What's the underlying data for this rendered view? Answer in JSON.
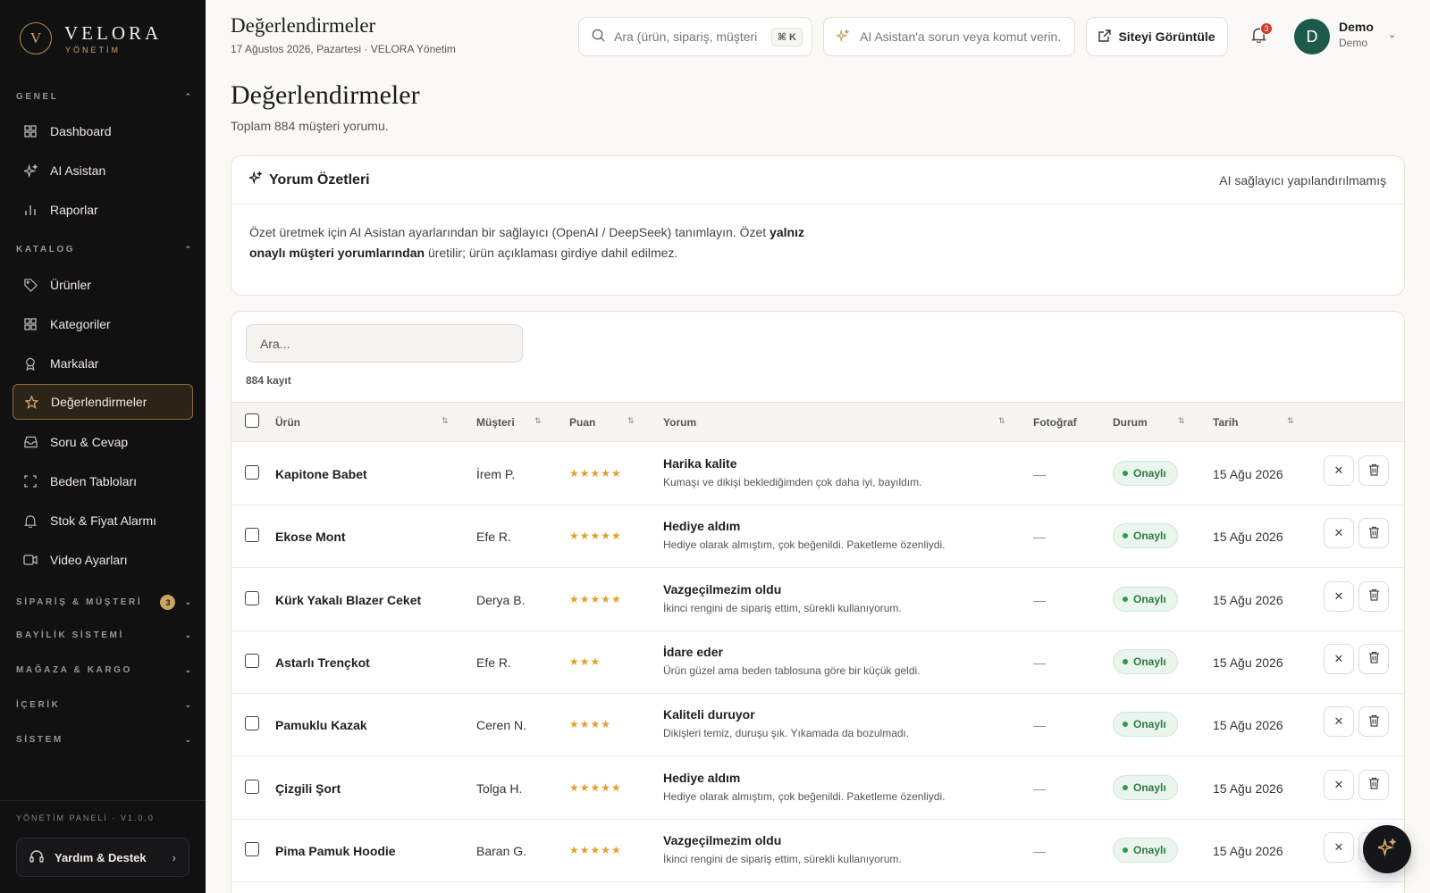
{
  "brand": {
    "logo_letter": "V",
    "name": "VELORA",
    "subtitle": "YÖNETİM"
  },
  "sidebar": {
    "sections": [
      {
        "label": "GENEL",
        "state": "expanded",
        "items": [
          {
            "label": "Dashboard",
            "icon": "grid-icon"
          },
          {
            "label": "AI Asistan",
            "icon": "sparkle-icon"
          },
          {
            "label": "Raporlar",
            "icon": "bar-chart-icon"
          }
        ]
      },
      {
        "label": "KATALOG",
        "state": "expanded",
        "items": [
          {
            "label": "Ürünler",
            "icon": "tag-icon"
          },
          {
            "label": "Kategoriler",
            "icon": "grid-icon"
          },
          {
            "label": "Markalar",
            "icon": "award-icon"
          },
          {
            "label": "Değerlendirmeler",
            "icon": "star-icon",
            "active": true
          },
          {
            "label": "Soru & Cevap",
            "icon": "inbox-icon"
          },
          {
            "label": "Beden Tabloları",
            "icon": "frame-icon"
          },
          {
            "label": "Stok & Fiyat Alarmı",
            "icon": "bell-icon"
          },
          {
            "label": "Video Ayarları",
            "icon": "video-icon"
          }
        ]
      },
      {
        "label": "SİPARİŞ & MÜŞTERİ",
        "state": "collapsed",
        "badge": "3"
      },
      {
        "label": "BAYİLİK SİSTEMİ",
        "state": "collapsed"
      },
      {
        "label": "MAĞAZA & KARGO",
        "state": "collapsed"
      },
      {
        "label": "İÇERİK",
        "state": "collapsed"
      },
      {
        "label": "SİSTEM",
        "state": "collapsed"
      }
    ],
    "version": "YÖNETİM PANELİ · V1.0.0",
    "help_label": "Yardım & Destek"
  },
  "header": {
    "title": "Değerlendirmeler",
    "date": "17 Ağustos 2026, Pazartesi · VELORA Yönetim",
    "search_placeholder": "Ara (ürün, sipariş, müşteri...",
    "search_shortcut": "⌘ K",
    "ai_placeholder": "AI Asistan'a sorun veya komut verin...",
    "view_site_label": "Siteyi Görüntüle",
    "notification_count": "3",
    "user": {
      "initial": "D",
      "name": "Demo",
      "role": "Demo"
    }
  },
  "page": {
    "title": "Değerlendirmeler",
    "subtitle": "Toplam 884 müşteri yorumu."
  },
  "summary": {
    "title": "Yorum Özetleri",
    "status": "AI sağlayıcı yapılandırılmamış",
    "body_pre": "Özet üretmek için AI Asistan ayarlarından bir sağlayıcı (OpenAI / DeepSeek) tanımlayın. Özet ",
    "body_bold": "yalnız onaylı müşteri yorumlarından",
    "body_post": " üretilir; ürün açıklaması girdiye dahil edilmez."
  },
  "reviews": {
    "search_placeholder": "Ara...",
    "record_count": "884 kayıt",
    "columns": [
      "Ürün",
      "Müşteri",
      "Puan",
      "Yorum",
      "Fotoğraf",
      "Durum",
      "Tarih"
    ],
    "rows": [
      {
        "product": "Kapitone Babet",
        "customer": "İrem P.",
        "rating": 5,
        "title": "Harika kalite",
        "text": "Kumaşı ve dikişi beklediğimden çok daha iyi, bayıldım.",
        "photo": "—",
        "status": "Onaylı",
        "date": "15 Ağu 2026"
      },
      {
        "product": "Ekose Mont",
        "customer": "Efe R.",
        "rating": 5,
        "title": "Hediye aldım",
        "text": "Hediye olarak almıştım, çok beğenildi. Paketleme özenliydi.",
        "photo": "—",
        "status": "Onaylı",
        "date": "15 Ağu 2026"
      },
      {
        "product": "Kürk Yakalı Blazer Ceket",
        "customer": "Derya B.",
        "rating": 5,
        "title": "Vazgeçilmezim oldu",
        "text": "İkinci rengini de sipariş ettim, sürekli kullanıyorum.",
        "photo": "—",
        "status": "Onaylı",
        "date": "15 Ağu 2026"
      },
      {
        "product": "Astarlı Trençkot",
        "customer": "Efe R.",
        "rating": 3,
        "title": "İdare eder",
        "text": "Ürün güzel ama beden tablosuna göre bir küçük geldi.",
        "photo": "—",
        "status": "Onaylı",
        "date": "15 Ağu 2026"
      },
      {
        "product": "Pamuklu Kazak",
        "customer": "Ceren N.",
        "rating": 4,
        "title": "Kaliteli duruyor",
        "text": "Dikişleri temiz, duruşu şık. Yıkamada da bozulmadı.",
        "photo": "—",
        "status": "Onaylı",
        "date": "15 Ağu 2026"
      },
      {
        "product": "Çizgili Şort",
        "customer": "Tolga H.",
        "rating": 5,
        "title": "Hediye aldım",
        "text": "Hediye olarak almıştım, çok beğenildi. Paketleme özenliydi.",
        "photo": "—",
        "status": "Onaylı",
        "date": "15 Ağu 2026"
      },
      {
        "product": "Pima Pamuk Hoodie",
        "customer": "Baran G.",
        "rating": 5,
        "title": "Vazgeçilmezim oldu",
        "text": "İkinci rengini de sipariş ettim, sürekli kullanıyorum.",
        "photo": "—",
        "status": "Onaylı",
        "date": "15 Ağu 2026"
      }
    ]
  },
  "colors": {
    "accent": "#c9a463",
    "sidebar_bg": "#111112",
    "status_green": "#2f7a47",
    "star": "#e2a02d",
    "avatar": "#1d5a4a"
  }
}
